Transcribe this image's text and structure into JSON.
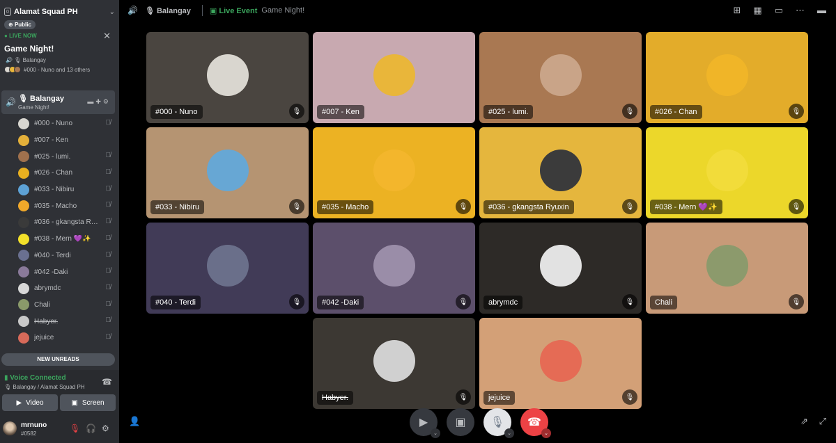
{
  "colors": {
    "sidebar": "#2f3136",
    "live_green": "#3ba55d",
    "hangup_red": "#ed4245"
  },
  "sidebar": {
    "server_name": "Alamat Squad PH",
    "server_badge": "0",
    "public_label": "Public",
    "live_now_label": "LIVE NOW",
    "event_title": "Game Night!",
    "event_stage": "Balangay",
    "event_people": "#000 - Nuno and 13 others",
    "channel": {
      "name": "Balangay",
      "subtitle": "Game Night!"
    },
    "members": [
      {
        "name": "#000 - Nuno",
        "muted": true,
        "color": "#d8d6d0"
      },
      {
        "name": "#007 - Ken",
        "muted": false,
        "color": "#e4b03a"
      },
      {
        "name": "#025 - lumi.",
        "muted": true,
        "color": "#a0714d"
      },
      {
        "name": "#026 - Chan",
        "muted": true,
        "color": "#e8b020"
      },
      {
        "name": "#033 - Nibiru",
        "muted": true,
        "color": "#5da2d6"
      },
      {
        "name": "#035 - Macho",
        "muted": true,
        "color": "#f0a82a"
      },
      {
        "name": "#036 - gkangsta Ryuxin",
        "muted": true,
        "color": "#3a3a3a"
      },
      {
        "name": "#038 - Mern 💜✨",
        "muted": true,
        "color": "#f3e02a"
      },
      {
        "name": "#040 - Terdi",
        "muted": true,
        "color": "#6a7090"
      },
      {
        "name": "#042 -Daki",
        "muted": true,
        "color": "#8a7a9a"
      },
      {
        "name": "abrymdc",
        "muted": true,
        "color": "#d8d8d8"
      },
      {
        "name": "Chali",
        "muted": true,
        "color": "#8a9a6a"
      },
      {
        "name": "Habyer.",
        "muted": true,
        "strike": true,
        "color": "#c8c8c8"
      },
      {
        "name": "jejuice",
        "muted": true,
        "color": "#d86a5a"
      }
    ],
    "new_unreads": "NEW UNREADS",
    "voice": {
      "status": "Voice Connected",
      "location": "Balangay / Alamat Squad PH",
      "video_label": "Video",
      "screen_label": "Screen"
    },
    "user": {
      "name": "mrnuno",
      "tag": "#0582"
    }
  },
  "topbar": {
    "channel": "Balangay",
    "live_label": "Live Event",
    "event_name": "Game Night!"
  },
  "tiles": [
    {
      "name": "#000 - Nuno",
      "bg": "#4a4540",
      "avatar": "#d9d6cf",
      "muted": true
    },
    {
      "name": "#007 - Ken",
      "bg": "#c8a9b0",
      "avatar": "#e9b63a",
      "muted": false
    },
    {
      "name": "#025 - lumi.",
      "bg": "#a97852",
      "avatar": "#c9a488",
      "muted": true
    },
    {
      "name": "#026 - Chan",
      "bg": "#e3ac2a",
      "avatar": "#f0b528",
      "muted": true
    },
    {
      "name": "#033 - Nibiru",
      "bg": "#b59472",
      "avatar": "#67a7d4",
      "muted": true
    },
    {
      "name": "#035 - Macho",
      "bg": "#ecb223",
      "avatar": "#f3b62c",
      "muted": true
    },
    {
      "name": "#036 - gkangsta Ryuxin",
      "bg": "#e5b63d",
      "avatar": "#3b3b3b",
      "muted": true
    },
    {
      "name": "#038 - Mern 💜✨",
      "bg": "#ecd72a",
      "avatar": "#f2dc3a",
      "muted": true
    },
    {
      "name": "#040 - Terdi",
      "bg": "#413b57",
      "avatar": "#6a6f8a",
      "muted": true
    },
    {
      "name": "#042 -Daki",
      "bg": "#5c4f6b",
      "avatar": "#9a8da8",
      "muted": true
    },
    {
      "name": "abrymdc",
      "bg": "#2d2a27",
      "avatar": "#e2e2e2",
      "muted": true
    },
    {
      "name": "Chali",
      "bg": "#c89a78",
      "avatar": "#8c9a6c",
      "muted": true
    },
    {
      "name": "Habyer.",
      "bg": "#3c3833",
      "avatar": "#d0d0d0",
      "muted": true,
      "strike": true
    },
    {
      "name": "jejuice",
      "bg": "#d3a077",
      "avatar": "#e56b55",
      "muted": true
    }
  ]
}
